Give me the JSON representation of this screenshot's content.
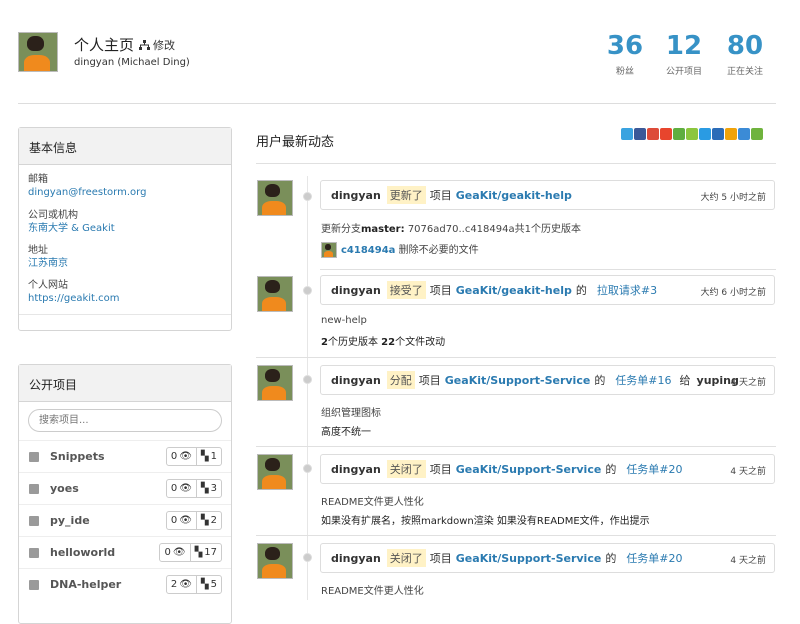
{
  "header": {
    "title": "个人主页",
    "edit_label": "修改",
    "username": "dingyan (Michael Ding)",
    "stats": [
      {
        "value": "36",
        "label": "粉丝"
      },
      {
        "value": "12",
        "label": "公开项目"
      },
      {
        "value": "80",
        "label": "正在关注"
      }
    ]
  },
  "basic_info": {
    "heading": "基本信息",
    "email_label": "邮箱",
    "email": "dingyan@freestorm.org",
    "company_label": "公司或机构",
    "company": "东南大学 & Geakit",
    "address_label": "地址",
    "address": "江苏南京",
    "website_label": "个人网站",
    "website": "https://geakit.com"
  },
  "projects": {
    "heading": "公开项目",
    "search_placeholder": "搜索项目...",
    "items": [
      {
        "name": "Snippets",
        "watchers": "0",
        "forks": "1"
      },
      {
        "name": "yoes",
        "watchers": "0",
        "forks": "3"
      },
      {
        "name": "py_ide",
        "watchers": "0",
        "forks": "2"
      },
      {
        "name": "helloworld",
        "watchers": "0",
        "forks": "17"
      },
      {
        "name": "DNA-helper",
        "watchers": "2",
        "forks": "5"
      }
    ]
  },
  "feed": {
    "title": "用户最新动态",
    "share_colors": [
      "#3aa3e0",
      "#3b5998",
      "#dd4b39",
      "#e8452d",
      "#5fae3f",
      "#8cc63e",
      "#2a9be3",
      "#2b6cb8",
      "#f0a30a",
      "#3b8bd6",
      "#6fb33d"
    ],
    "events": [
      {
        "user": "dingyan",
        "action": "更新了",
        "word": "项目",
        "repo": "GeaKit/geakit-help",
        "time": "大约 5 小时之前",
        "line1_prefix": "更新分支",
        "line1_branch": "master:",
        "line1_rest": "7076ad70..c418494a共1个历史版本",
        "commit_hash": "c418494a",
        "commit_msg": "删除不必要的文件"
      },
      {
        "user": "dingyan",
        "action": "接受了",
        "word": "项目",
        "repo": "GeaKit/geakit-help",
        "of": "的",
        "target": "拉取请求#3",
        "time": "大约 6 小时之前",
        "line1": "new-help",
        "line2_n1": "2",
        "line2_t1": "个历史版本 ",
        "line2_n2": "22",
        "line2_t2": "个文件改动"
      },
      {
        "user": "dingyan",
        "action": "分配",
        "word": "项目",
        "repo": "GeaKit/Support-Service",
        "of": "的",
        "target": "任务单#16",
        "assign_word": "给",
        "assignee": "yuping",
        "time": "4 天之前",
        "line1": "组织管理图标",
        "line2": "高度不统一"
      },
      {
        "user": "dingyan",
        "action": "关闭了",
        "word": "项目",
        "repo": "GeaKit/Support-Service",
        "of": "的",
        "target": "任务单#20",
        "time": "4 天之前",
        "line1": "README文件更人性化",
        "line2": "如果没有扩展名，按照markdown渲染 如果没有README文件，作出提示"
      },
      {
        "user": "dingyan",
        "action": "关闭了",
        "word": "项目",
        "repo": "GeaKit/Support-Service",
        "of": "的",
        "target": "任务单#20",
        "time": "4 天之前",
        "line1": "README文件更人性化"
      }
    ]
  }
}
